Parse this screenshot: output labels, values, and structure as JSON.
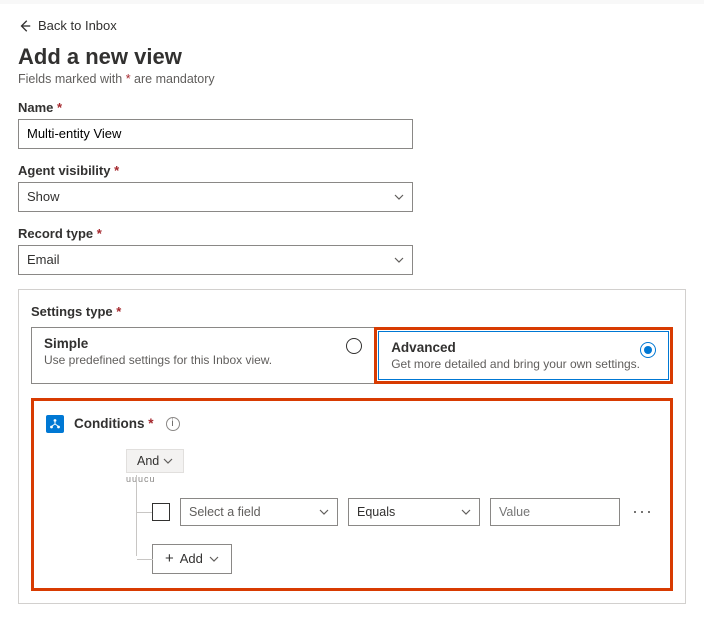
{
  "back_link": "Back to Inbox",
  "title": "Add a new view",
  "subtitle_prefix": "Fields marked with ",
  "subtitle_suffix": " are mandatory",
  "asterisk": "*",
  "fields": {
    "name": {
      "label": "Name",
      "value": "Multi-entity View"
    },
    "agent_visibility": {
      "label": "Agent visibility",
      "value": "Show"
    },
    "record_type": {
      "label": "Record type",
      "value": "Email"
    }
  },
  "settings_type": {
    "label": "Settings type",
    "simple": {
      "title": "Simple",
      "desc": "Use predefined settings for this Inbox view."
    },
    "advanced": {
      "title": "Advanced",
      "desc": "Get more detailed and bring your own settings."
    },
    "selected": "advanced"
  },
  "conditions": {
    "title": "Conditions",
    "operator": "And",
    "cut_line": "uuucu",
    "row": {
      "field_placeholder": "Select a field",
      "operator": "Equals",
      "value_placeholder": "Value"
    },
    "add_label": "Add",
    "plus": "+"
  }
}
